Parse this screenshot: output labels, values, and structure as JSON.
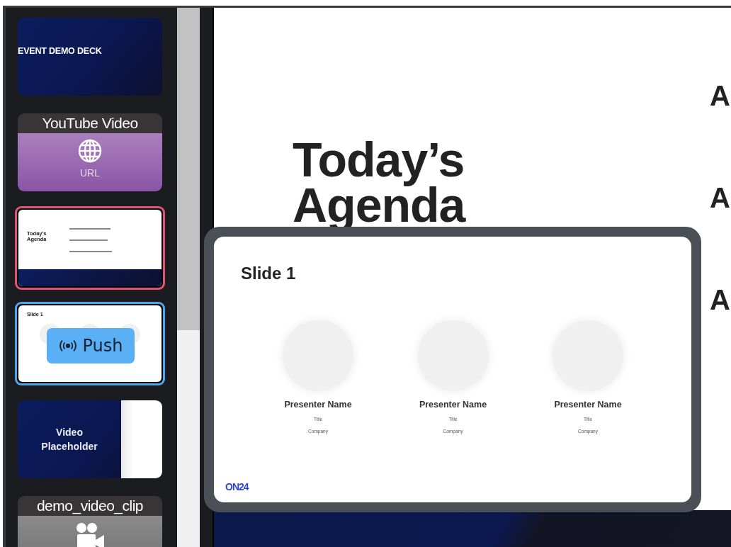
{
  "sidebar": {
    "push_button": {
      "label": "Push"
    },
    "thumbnails": [
      {
        "kind": "title",
        "label": "EVENT DEMO DECK",
        "selected": false,
        "hovered": false
      },
      {
        "kind": "url",
        "label": "YouTube Video",
        "caption": "URL",
        "selected": false,
        "hovered": false
      },
      {
        "kind": "agenda",
        "label": "Today’s Agenda",
        "selected": true,
        "hovered": false
      },
      {
        "kind": "speakers",
        "label": "Slide 1",
        "selected": false,
        "hovered": true
      },
      {
        "kind": "video_placeholder",
        "label": "Video Placeholder",
        "selected": false,
        "hovered": false
      },
      {
        "kind": "video",
        "label": "demo_video_clip",
        "selected": false,
        "hovered": false
      }
    ]
  },
  "main_slide": {
    "title": "Today’s Agenda",
    "agenda_items": [
      "A",
      "A",
      "A"
    ]
  },
  "preview": {
    "title": "Slide 1",
    "logo": "ON24",
    "presenters": [
      {
        "name": "Presenter Name",
        "title": "Title",
        "company": "Company"
      },
      {
        "name": "Presenter Name",
        "title": "Title",
        "company": "Company"
      },
      {
        "name": "Presenter Name",
        "title": "Title",
        "company": "Company"
      }
    ]
  }
}
